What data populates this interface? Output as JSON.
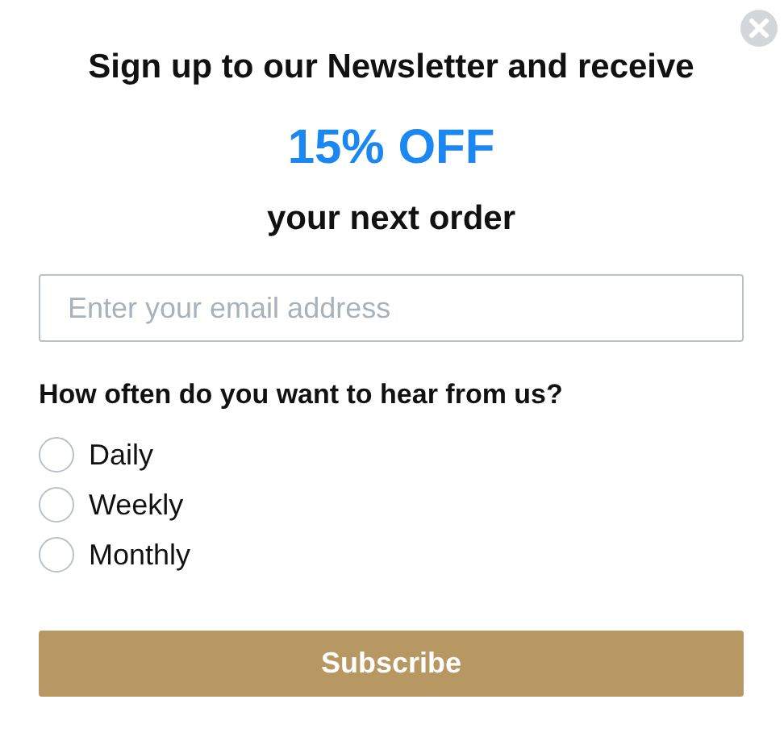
{
  "heading": {
    "line_1": "Sign up to our Newsletter and receive",
    "offer": "15% OFF",
    "line_2": "your next order"
  },
  "email_field": {
    "placeholder": "Enter your email address"
  },
  "question": "How often do you want to hear from us?",
  "options": [
    {
      "label": "Daily",
      "selected": false
    },
    {
      "label": "Weekly",
      "selected": false
    },
    {
      "label": "Monthly",
      "selected": false
    }
  ],
  "submit_button": {
    "label": "Subscribe"
  }
}
